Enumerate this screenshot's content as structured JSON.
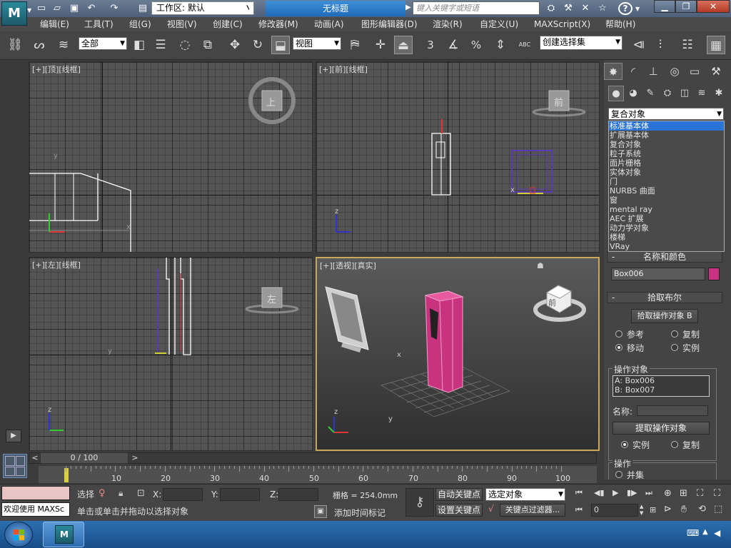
{
  "titlebar": {
    "workspace": "工作区: 默认",
    "doc_title": "无标题",
    "search_placeholder": "键入关键字或短语",
    "help": "?"
  },
  "menu": [
    "编辑(E)",
    "工具(T)",
    "组(G)",
    "视图(V)",
    "创建(C)",
    "修改器(M)",
    "动画(A)",
    "图形编辑器(D)",
    "渲染(R)",
    "自定义(U)",
    "MAXScript(X)",
    "帮助(H)"
  ],
  "toolbar": {
    "selection_filter": "全部",
    "ref_coord": "视图",
    "named_selection": "创建选择集",
    "snap_3": "3",
    "percent": "%",
    "abc": "ABC"
  },
  "viewports": {
    "top": {
      "label": "[+][顶][线框]",
      "cube": "上"
    },
    "front": {
      "label": "[+][前][线框]",
      "cube": "前"
    },
    "left": {
      "label": "[+][左][线框]",
      "cube": "左"
    },
    "persp": {
      "label": "[+][透视][真实]",
      "cube": "前"
    }
  },
  "command_panel": {
    "category": "复合对象",
    "dropdown_options": [
      "标准基本体",
      "扩展基本体",
      "复合对象",
      "粒子系统",
      "面片栅格",
      "实体对象",
      "门",
      "NURBS 曲面",
      "窗",
      "mental ray",
      "AEC 扩展",
      "动力学对象",
      "楼梯",
      "VRay"
    ],
    "selected_index": 0,
    "name_color_title": "名称和颜色",
    "object_name": "Box006",
    "object_color": "#c8327e",
    "pick_boolean_title": "拾取布尔",
    "pick_operand_button": "拾取操作对象 B",
    "radio_reference": "参考",
    "radio_copy": "复制",
    "radio_move": "移动",
    "radio_instance": "实例",
    "operands_title": "操作对象",
    "operand_a": "A: Box006",
    "operand_b": "B: Box007",
    "name_label": "名称:",
    "extract_button": "提取操作对象",
    "radio_instance2": "实例",
    "radio_copy2": "复制",
    "operation_title": "操作",
    "union": "并集"
  },
  "timeline": {
    "frame_display": "0 / 100",
    "ticks": [
      "10",
      "20",
      "30",
      "40",
      "50",
      "60",
      "70",
      "80",
      "90",
      "100"
    ]
  },
  "status": {
    "maxscript": "欢迎使用 MAXSc",
    "select_label": "选择",
    "x_label": "X:",
    "y_label": "Y:",
    "z_label": "Z:",
    "grid": "栅格 = 254.0mm",
    "auto_key": "自动关键点",
    "selected_object": "选定对象",
    "set_key": "设置关键点",
    "key_filter": "关键点过滤器...",
    "prompt": "单击或单击并拖动以选择对象",
    "add_time_tag": "添加时间标记",
    "frame": "0"
  },
  "colors": {
    "accent_blue": "#2b73d6",
    "viewport_gray": "#545454",
    "active_border": "#c9a85c",
    "pink_object": "#c8327e"
  }
}
